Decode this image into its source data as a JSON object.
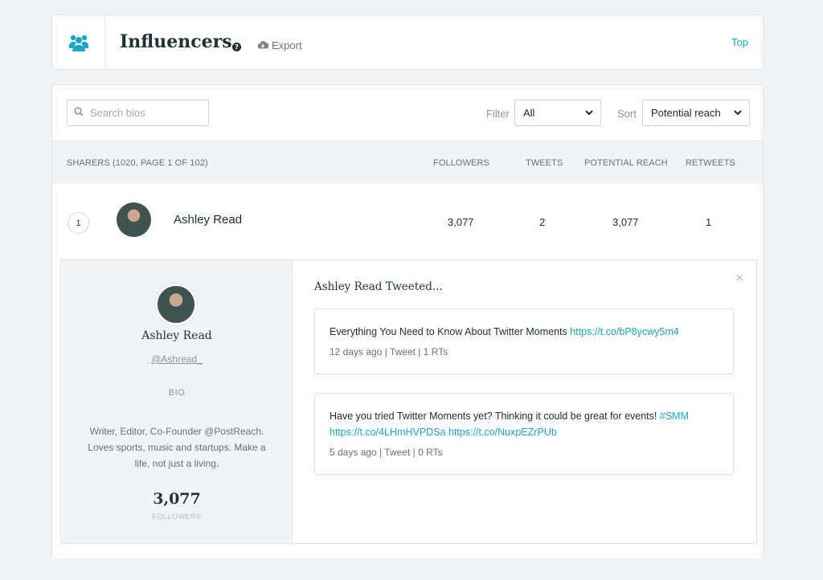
{
  "header": {
    "title": "Influencers",
    "export_label": "Export",
    "top_label": "Top"
  },
  "toolbar": {
    "search_placeholder": "Search bios",
    "filter_label": "Filter",
    "filter_value": "All",
    "sort_label": "Sort",
    "sort_value": "Potential reach"
  },
  "table": {
    "summary": "SHARERS (1020, PAGE 1 OF 102)",
    "columns": [
      "FOLLOWERS",
      "TWEETS",
      "POTENTIAL REACH",
      "RETWEETS"
    ],
    "rows": [
      {
        "rank": "1",
        "name": "Ashley Read",
        "followers": "3,077",
        "tweets": "2",
        "potential_reach": "3,077",
        "retweets": "1"
      }
    ]
  },
  "detail": {
    "name": "Ashley Read",
    "handle": "@Ashread_",
    "bio_label": "BIO",
    "bio": "Writer, Editor, Co-Founder @PostReach. Loves sports, music and startups. Make a life, not just a living.",
    "followers": "3,077",
    "followers_label": "FOLLOWERS",
    "tweeted_title": "Ashley Read Tweeted...",
    "close_icon": "×",
    "tweets": [
      {
        "text": "Everything You Need to Know About Twitter Moments",
        "links": [
          "https://t.co/bP8ycwy5m4"
        ],
        "meta": "12 days ago | Tweet | 1 RTs"
      },
      {
        "text": "Have you tried Twitter Moments yet? Thinking it could be great for events!",
        "hashtag": "#SMM",
        "links": [
          "https://t.co/4LHmHVPDSa",
          "https://t.co/NuxpEZrPUb"
        ],
        "meta": "5 days ago | Tweet | 0 RTs"
      }
    ]
  },
  "colors": {
    "accent": "#18a8c6",
    "background": "#f2f3f5",
    "title": "#1f3336"
  },
  "icons": [
    "users-icon",
    "help-icon",
    "cloud-download-icon",
    "search-icon",
    "chevron-down-icon",
    "close-icon"
  ]
}
